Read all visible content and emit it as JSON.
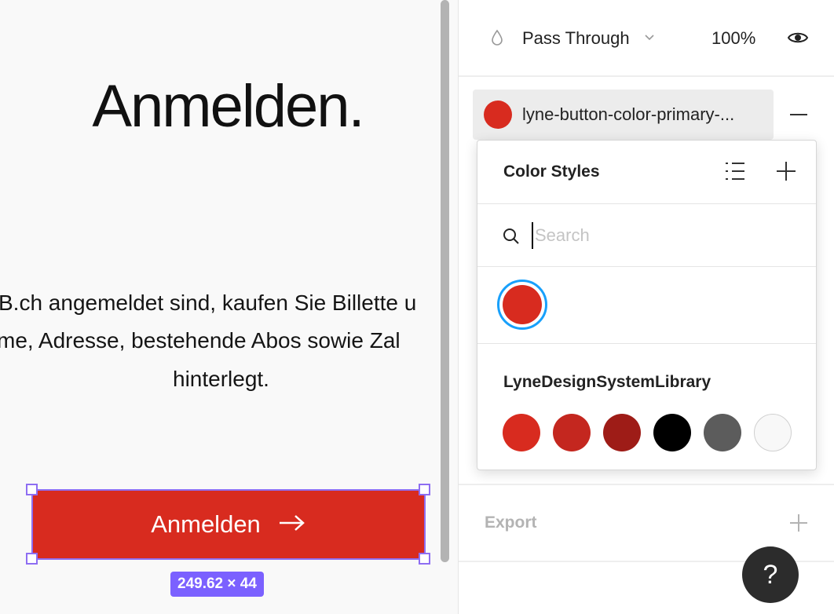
{
  "canvas": {
    "heading": "Anmelden.",
    "body_lines": [
      "B.ch angemeldet sind, kaufen Sie Billette u",
      "me, Adresse, bestehende Abos sowie Zal",
      "hinterlegt."
    ],
    "button": {
      "label": "Anmelden",
      "arrow": "→",
      "color": "#d82b1f"
    },
    "selection_size": "249.62 × 44"
  },
  "panel": {
    "layer": {
      "blend_mode": "Pass Through",
      "opacity": "100%",
      "icons": [
        "drop-icon",
        "chevron-down-icon",
        "eye-icon"
      ]
    },
    "fill": {
      "style_name": "lyne-button-color-primary-...",
      "color": "#d82b1f"
    },
    "export_label": "Export",
    "help_label": "?"
  },
  "color_styles_popover": {
    "title": "Color Styles",
    "search_placeholder": "Search",
    "search_value": "",
    "selected_color": "#d82b1f",
    "library_name": "LyneDesignSystemLibrary",
    "library_swatches": [
      "#d82b1f",
      "#c4271f",
      "#9e1c17",
      "#000000",
      "#5c5c5c",
      "#f8f8f8"
    ]
  }
}
